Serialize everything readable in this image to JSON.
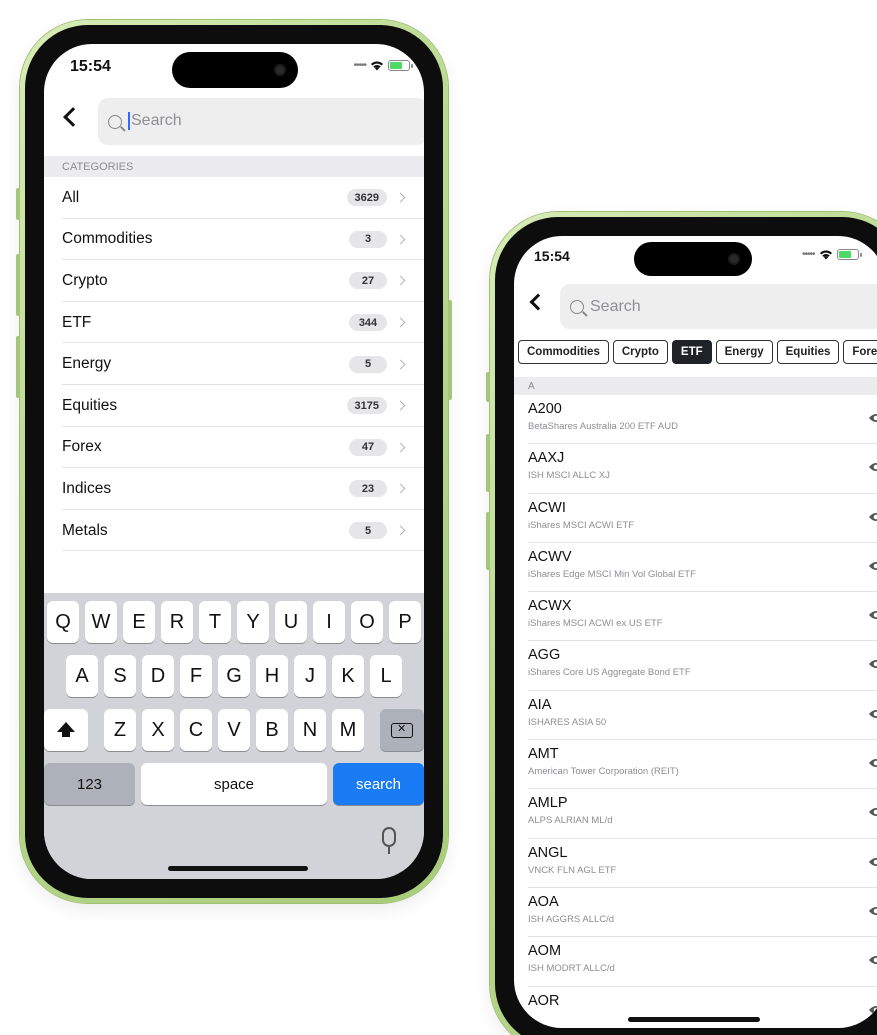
{
  "phone1": {
    "status": {
      "time": "15:54"
    },
    "search": {
      "placeholder": "Search"
    },
    "section_header": "CATEGORIES",
    "categories": [
      {
        "label": "All",
        "count": "3629"
      },
      {
        "label": "Commodities",
        "count": "3"
      },
      {
        "label": "Crypto",
        "count": "27"
      },
      {
        "label": "ETF",
        "count": "344"
      },
      {
        "label": "Energy",
        "count": "5"
      },
      {
        "label": "Equities",
        "count": "3175"
      },
      {
        "label": "Forex",
        "count": "47"
      },
      {
        "label": "Indices",
        "count": "23"
      },
      {
        "label": "Metals",
        "count": "5"
      }
    ],
    "keyboard": {
      "row1": [
        "Q",
        "W",
        "E",
        "R",
        "T",
        "Y",
        "U",
        "I",
        "O",
        "P"
      ],
      "row2": [
        "A",
        "S",
        "D",
        "F",
        "G",
        "H",
        "J",
        "K",
        "L"
      ],
      "row3": [
        "Z",
        "X",
        "C",
        "V",
        "B",
        "N",
        "M"
      ],
      "num_label": "123",
      "space_label": "space",
      "search_label": "search"
    }
  },
  "phone2": {
    "status": {
      "time": "15:54"
    },
    "search": {
      "placeholder": "Search"
    },
    "chips": [
      {
        "label": "Commodities",
        "active": false
      },
      {
        "label": "Crypto",
        "active": false
      },
      {
        "label": "ETF",
        "active": true
      },
      {
        "label": "Energy",
        "active": false
      },
      {
        "label": "Equities",
        "active": false
      },
      {
        "label": "Forex",
        "active": false
      }
    ],
    "letter_header": "A",
    "instruments": [
      {
        "symbol": "A200",
        "name": "BetaShares Australia 200 ETF AUD"
      },
      {
        "symbol": "AAXJ",
        "name": "ISH MSCI ALLC XJ"
      },
      {
        "symbol": "ACWI",
        "name": "iShares MSCI ACWI ETF"
      },
      {
        "symbol": "ACWV",
        "name": "iShares Edge MSCI Min Vol Global ETF"
      },
      {
        "symbol": "ACWX",
        "name": "iShares MSCI ACWI ex US ETF"
      },
      {
        "symbol": "AGG",
        "name": "iShares Core US Aggregate Bond ETF"
      },
      {
        "symbol": "AIA",
        "name": "ISHARES ASIA 50"
      },
      {
        "symbol": "AMT",
        "name": "American Tower Corporation (REIT)"
      },
      {
        "symbol": "AMLP",
        "name": "ALPS ALRIAN ML/d"
      },
      {
        "symbol": "ANGL",
        "name": "VNCK FLN AGL ETF"
      },
      {
        "symbol": "AOA",
        "name": "ISH AGGRS ALLC/d"
      },
      {
        "symbol": "AOM",
        "name": "ISH MODRT ALLC/d"
      },
      {
        "symbol": "AOR",
        "name": ""
      }
    ]
  },
  "colors": {
    "frame": "#b9d98f",
    "accent_blue": "#1a7cf5",
    "chip_active": "#1f2328"
  }
}
